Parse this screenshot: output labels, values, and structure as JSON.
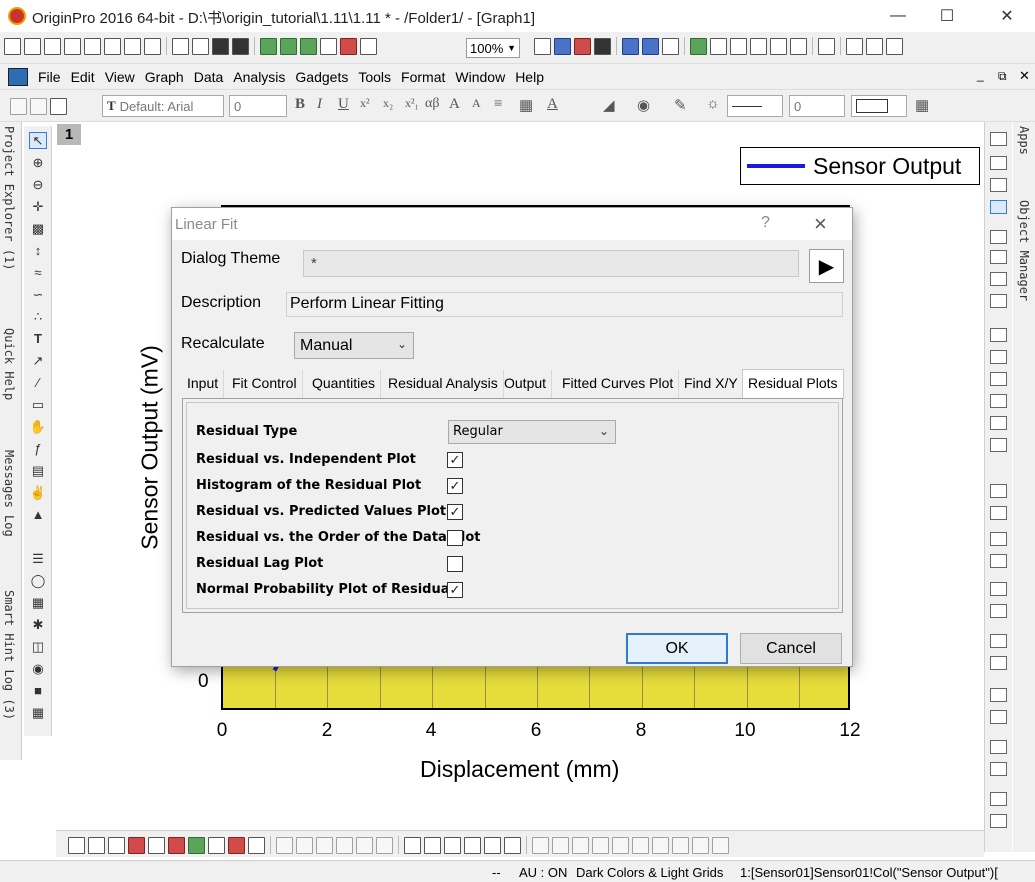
{
  "window": {
    "title": "OriginPro 2016 64-bit - D:\\书\\origin_tutorial\\1.11\\1.11 * - /Folder1/ - [Graph1]",
    "minimize_icon": "minimize-icon",
    "maximize_icon": "maximize-icon",
    "close_icon": "close-icon"
  },
  "toolbar": {
    "zoom": "100%"
  },
  "menu": [
    "File",
    "Edit",
    "View",
    "Graph",
    "Data",
    "Analysis",
    "Gadgets",
    "Tools",
    "Format",
    "Window",
    "Help"
  ],
  "format_bar": {
    "font": "Default: Arial",
    "size": "0",
    "line_size": "0"
  },
  "left_dock": {
    "panels": [
      "Project Explorer (1)",
      "Quick Help",
      "Messages Log",
      "Smart Hint Log (3)"
    ]
  },
  "right_dock": {
    "panels": [
      "Apps",
      "Object Manager"
    ]
  },
  "graph": {
    "layer": "1",
    "legend": "Sensor Output",
    "x_axis_title": "Displacement (mm)",
    "y_axis_title": "Sensor Output (mV)",
    "x_ticks": [
      "0",
      "2",
      "4",
      "6",
      "8",
      "10",
      "12"
    ],
    "y_zero": "0",
    "colors": {
      "plot_bg": "#e6dc3a",
      "series": "#1a1adf"
    }
  },
  "dialog": {
    "title": "Linear Fit",
    "help": "?",
    "theme_label": "Dialog Theme",
    "theme_value": "*",
    "description_label": "Description",
    "description_value": "Perform Linear Fitting",
    "recalc_label": "Recalculate",
    "recalc_value": "Manual",
    "tabs": [
      "Input",
      "Fit Control",
      "Quantities",
      "Residual Analysis",
      "Output",
      "Fitted Curves Plot",
      "Find X/Y",
      "Residual Plots"
    ],
    "active_tab": "Residual Plots",
    "residual_type_label": "Residual Type",
    "residual_type_value": "Regular",
    "options": [
      {
        "label": "Residual vs. Independent Plot",
        "checked": true
      },
      {
        "label": "Histogram of the Residual Plot",
        "checked": true
      },
      {
        "label": "Residual vs. Predicted Values Plot",
        "checked": true
      },
      {
        "label": "Residual vs. the Order of the Data Plot",
        "checked": false
      },
      {
        "label": "Residual Lag Plot",
        "checked": false
      },
      {
        "label": "Normal Probability Plot of Residuals",
        "checked": true
      }
    ],
    "ok": "OK",
    "cancel": "Cancel"
  },
  "status": {
    "left": "--",
    "au": "AU : ON",
    "theme": "Dark Colors & Light Grids",
    "ref": "1:[Sensor01]Sensor01!Col(\"Sensor Output\")["
  }
}
